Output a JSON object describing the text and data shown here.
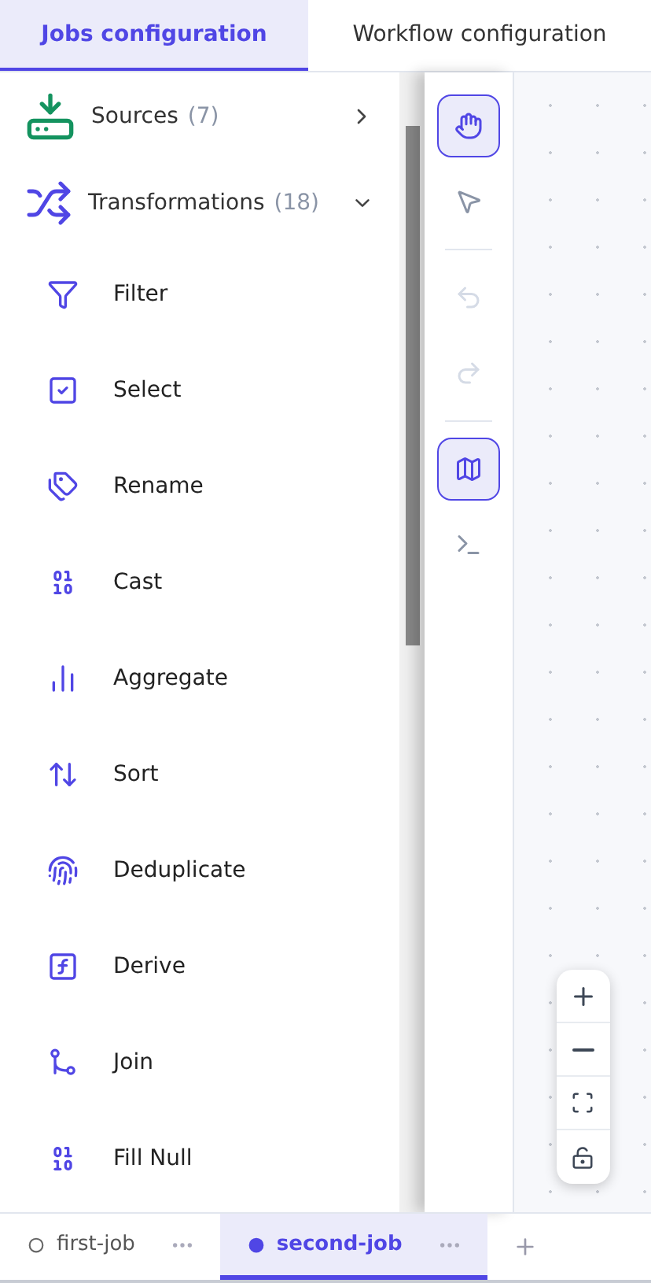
{
  "tabs": [
    {
      "label": "Jobs configuration",
      "selected": true
    },
    {
      "label": "Workflow configuration",
      "selected": false
    }
  ],
  "sidebar": {
    "groups": [
      {
        "label": "Sources",
        "count": "(7)",
        "expanded": false
      },
      {
        "label": "Transformations",
        "count": "(18)",
        "expanded": true
      }
    ],
    "items": [
      {
        "label": "Filter"
      },
      {
        "label": "Select"
      },
      {
        "label": "Rename"
      },
      {
        "label": "Cast"
      },
      {
        "label": "Aggregate"
      },
      {
        "label": "Sort"
      },
      {
        "label": "Deduplicate"
      },
      {
        "label": "Derive"
      },
      {
        "label": "Join"
      },
      {
        "label": "Fill Null"
      }
    ]
  },
  "toolbar": [
    {
      "selected": true,
      "disabled": false
    },
    {
      "selected": false,
      "disabled": false
    },
    {
      "selected": false,
      "disabled": true
    },
    {
      "selected": false,
      "disabled": true
    },
    {
      "selected": true,
      "disabled": false
    },
    {
      "selected": false,
      "disabled": false
    }
  ],
  "job_tabs": [
    {
      "label": "first-job",
      "selected": false
    },
    {
      "label": "second-job",
      "selected": true
    }
  ]
}
